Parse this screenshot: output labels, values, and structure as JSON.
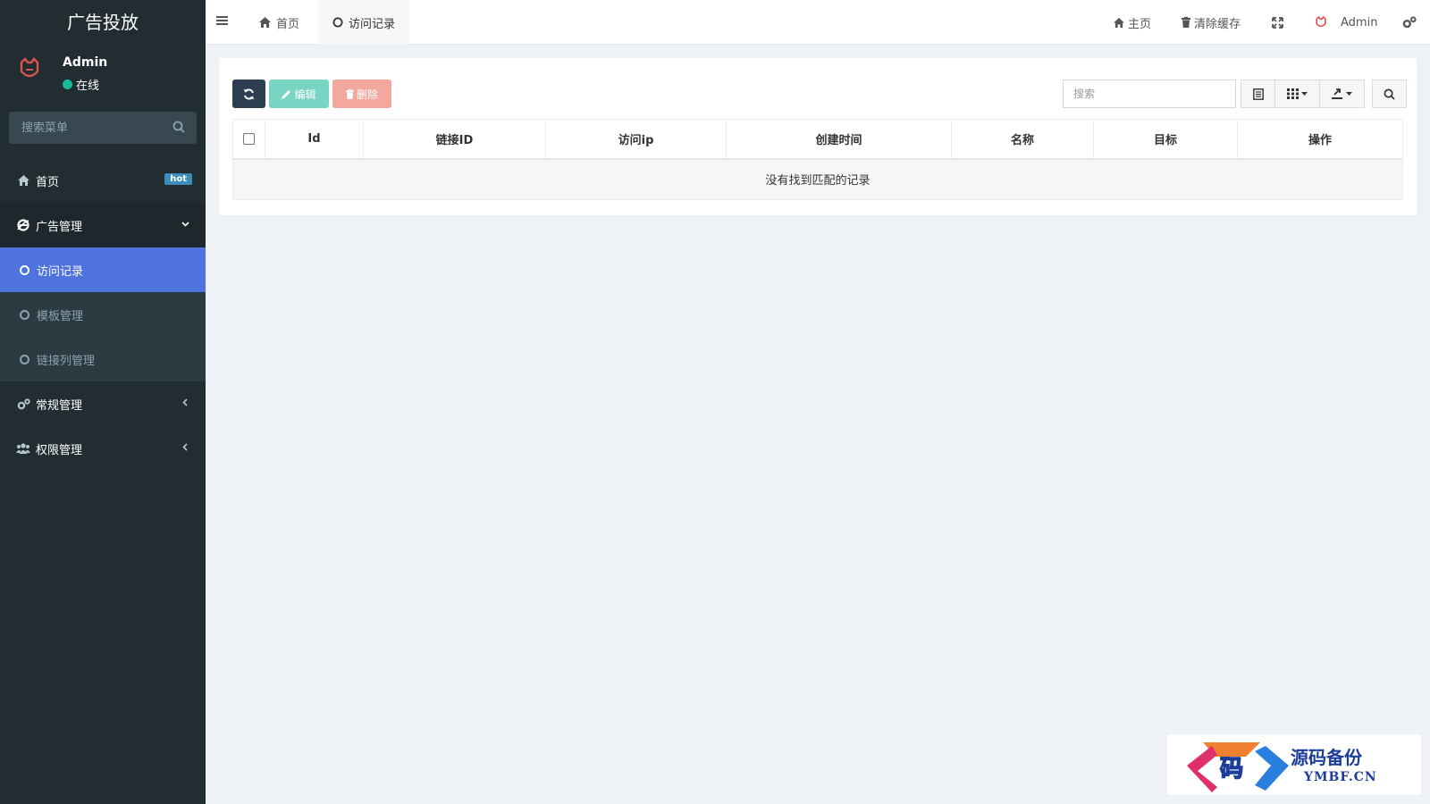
{
  "sidebar": {
    "logo_text": "广告投放",
    "user": {
      "name": "Admin",
      "status": "在线"
    },
    "search_placeholder": "搜索菜单",
    "items": [
      {
        "label": "首页",
        "icon": "home-icon",
        "badge": "hot"
      },
      {
        "label": "广告管理",
        "icon": "ie-icon",
        "open": true,
        "children": [
          {
            "label": "访问记录",
            "active": true
          },
          {
            "label": "模板管理"
          },
          {
            "label": "链接列管理"
          }
        ]
      },
      {
        "label": "常规管理",
        "icon": "cogs-icon"
      },
      {
        "label": "权限管理",
        "icon": "users-icon"
      }
    ]
  },
  "topbar": {
    "tabs": [
      {
        "label": "首页",
        "icon": "home-icon"
      },
      {
        "label": "访问记录",
        "icon": "circle-icon"
      }
    ],
    "right": {
      "home": "主页",
      "clear_cache": "清除缓存",
      "user": "Admin"
    }
  },
  "toolbar": {
    "edit_label": "编辑",
    "delete_label": "删除",
    "search_placeholder": "搜索"
  },
  "table": {
    "columns": [
      "Id",
      "链接ID",
      "访问ip",
      "创建时间",
      "名称",
      "目标",
      "操作"
    ],
    "empty_text": "没有找到匹配的记录"
  },
  "watermark": {
    "cn": "源码备份",
    "en": "YMBF.CN",
    "glyph": "码"
  },
  "colors": {
    "sidebar_bg": "#222d32",
    "active_item": "#4e73df",
    "badge": "#3c8dbc",
    "online": "#18bc9c",
    "btn_refresh": "#2c3e50",
    "btn_edit": "#7ad4c3",
    "btn_delete": "#f3a79d"
  }
}
